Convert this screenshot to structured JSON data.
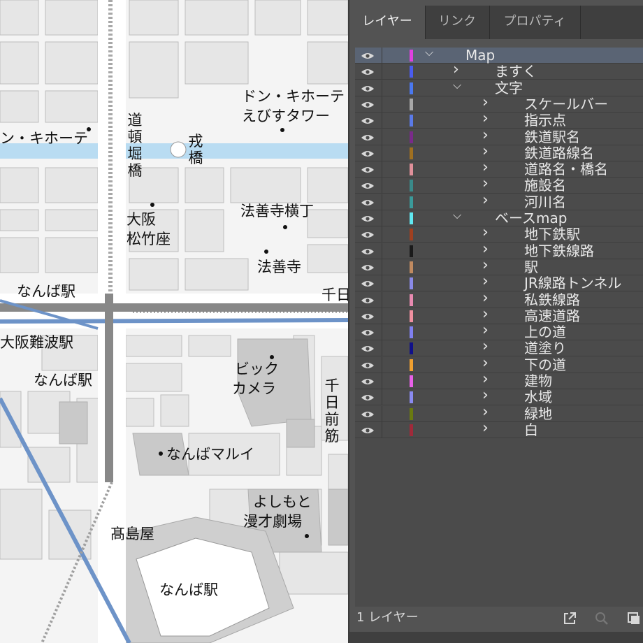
{
  "map": {
    "labels": {
      "donki_left": "ン・キホーテ",
      "donki_ebisu_1": "ドン・キホーテ",
      "donki_ebisu_2": "えびすタワー",
      "dotonbori": "道頓堀橋",
      "ebisu": "戎橋",
      "shochikuza_1": "大阪",
      "shochikuza_2": "松竹座",
      "hozenji_yokocho": "法善寺横丁",
      "hozenji": "法善寺",
      "namba_station_1": "なんば駅",
      "sennichi_cut": "千日",
      "osaka_namba": "大阪難波駅",
      "namba_station_2": "なんば駅",
      "bic_1": "ビック",
      "bic_2": "カメラ",
      "sennichimae": "千日前筋",
      "marui": "なんばマルイ",
      "yoshimoto_1": "よしもと",
      "yoshimoto_2": "漫才劇場",
      "takashimaya": "髙島屋",
      "namba_station_3": "なんば駅"
    }
  },
  "panel": {
    "tabs": [
      "レイヤー",
      "リンク",
      "プロパティ"
    ],
    "active_tab": "レイヤー",
    "layers": [
      {
        "name": "Map",
        "color": "#e040e0",
        "expanded": true,
        "selected": true,
        "level": 0
      },
      {
        "name": "ますく",
        "color": "#4a5cf0",
        "expanded": false,
        "level": 1
      },
      {
        "name": "文字",
        "color": "#4a78f0",
        "expanded": true,
        "level": 1
      },
      {
        "name": "スケールバー",
        "color": "#a8a8a8",
        "expanded": false,
        "level": 2
      },
      {
        "name": "指示点",
        "color": "#5a7ae8",
        "expanded": false,
        "level": 2
      },
      {
        "name": "鉄道駅名",
        "color": "#7a2a8a",
        "expanded": false,
        "level": 2
      },
      {
        "name": "鉄道路線名",
        "color": "#a07020",
        "expanded": false,
        "level": 2
      },
      {
        "name": "道路名・橋名",
        "color": "#e0909a",
        "expanded": false,
        "level": 2
      },
      {
        "name": "施設名",
        "color": "#3a8a8a",
        "expanded": false,
        "level": 2
      },
      {
        "name": "河川名",
        "color": "#3a9a9a",
        "expanded": false,
        "level": 2
      },
      {
        "name": "ベースmap",
        "color": "#60e8f0",
        "expanded": true,
        "level": 1
      },
      {
        "name": "地下鉄駅",
        "color": "#a04020",
        "expanded": false,
        "level": 2
      },
      {
        "name": "地下鉄線路",
        "color": "#1a1a1a",
        "expanded": false,
        "level": 2
      },
      {
        "name": "駅",
        "color": "#c08a60",
        "expanded": false,
        "level": 2
      },
      {
        "name": "JR線路トンネル",
        "color": "#8a8ae8",
        "expanded": false,
        "level": 2
      },
      {
        "name": "私鉄線路",
        "color": "#e88ab0",
        "expanded": false,
        "level": 2
      },
      {
        "name": "高速道路",
        "color": "#f090a0",
        "expanded": false,
        "level": 2
      },
      {
        "name": "上の道",
        "color": "#8080f0",
        "expanded": false,
        "level": 2
      },
      {
        "name": "道塗り",
        "color": "#10108a",
        "expanded": false,
        "level": 2
      },
      {
        "name": "下の道",
        "color": "#f0a030",
        "expanded": false,
        "level": 2
      },
      {
        "name": "建物",
        "color": "#e860e8",
        "expanded": false,
        "level": 2
      },
      {
        "name": "水域",
        "color": "#8a8af0",
        "expanded": false,
        "level": 2
      },
      {
        "name": "緑地",
        "color": "#6a7a10",
        "expanded": false,
        "level": 2
      },
      {
        "name": "白",
        "color": "#a02a3a",
        "expanded": false,
        "level": 2
      }
    ],
    "footer": {
      "count_text": "1 レイヤー"
    }
  }
}
